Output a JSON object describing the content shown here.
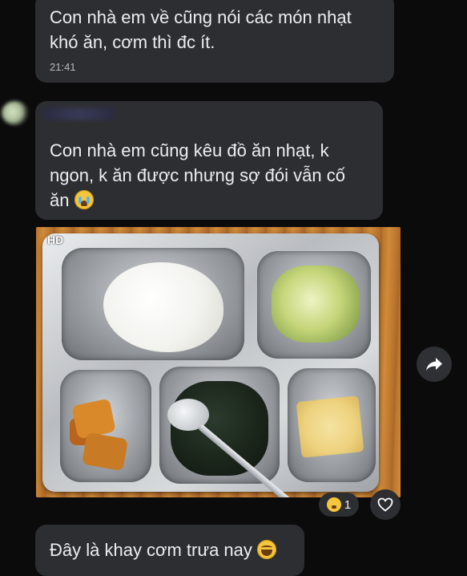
{
  "messages": [
    {
      "text": "Con nhà em về cũng nói các món nhạt khó ăn, cơm thì đc ít.",
      "time": "21:41"
    },
    {
      "text": "Con nhà em cũng kêu đồ ăn nhạt, k ngon, k ăn được nhưng sợ đói vẫn cố ăn",
      "emoji": "crying-face"
    }
  ],
  "photo": {
    "badge": "HD"
  },
  "reactions": {
    "emoji": "laughing-face",
    "count": "1"
  },
  "last_message": {
    "text": "Đây là khay cơm trưa nay",
    "emoji": "grinning-squinting-face"
  },
  "icons": {
    "share": "share-arrow-icon",
    "heart": "heart-outline-icon"
  },
  "colors": {
    "bubble": "#2d2e31",
    "background": "#0b0b0c"
  }
}
